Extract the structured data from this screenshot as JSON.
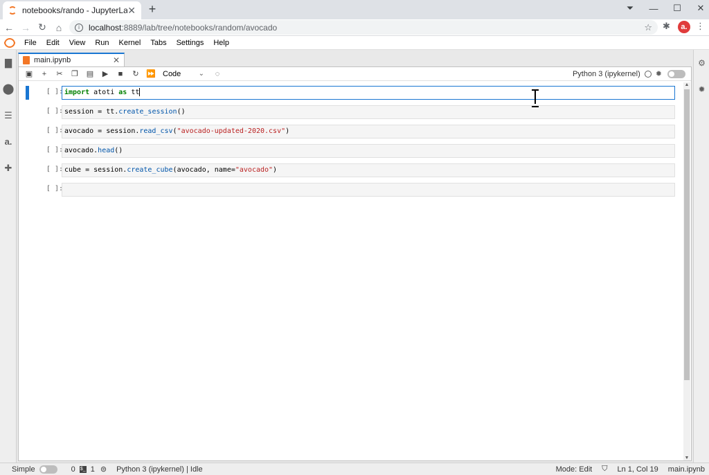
{
  "browser": {
    "tab_title": "notebooks/rando - JupyterLab",
    "url_host": "localhost",
    "url_path": ":8889/lab/tree/notebooks/random/avocado",
    "profile_initial": "a."
  },
  "menu": [
    "File",
    "Edit",
    "View",
    "Run",
    "Kernel",
    "Tabs",
    "Settings",
    "Help"
  ],
  "document": {
    "tab_name": "main.ipynb",
    "cell_type": "Code",
    "kernel_name": "Python 3 (ipykernel)"
  },
  "cells": [
    {
      "prompt": "[ ]:",
      "tokens": [
        {
          "t": "import",
          "c": "kw"
        },
        {
          "t": " atoti ",
          "c": ""
        },
        {
          "t": "as",
          "c": "kw"
        },
        {
          "t": " tt",
          "c": ""
        }
      ]
    },
    {
      "prompt": "[ ]:",
      "tokens": [
        {
          "t": "session = tt.",
          "c": ""
        },
        {
          "t": "create_session",
          "c": "fn"
        },
        {
          "t": "()",
          "c": ""
        }
      ]
    },
    {
      "prompt": "[ ]:",
      "tokens": [
        {
          "t": "avocado = session.",
          "c": ""
        },
        {
          "t": "read_csv",
          "c": "fn"
        },
        {
          "t": "(",
          "c": ""
        },
        {
          "t": "\"avocado-updated-2020.csv\"",
          "c": "str"
        },
        {
          "t": ")",
          "c": ""
        }
      ]
    },
    {
      "prompt": "[ ]:",
      "tokens": [
        {
          "t": "avocado.",
          "c": ""
        },
        {
          "t": "head",
          "c": "fn"
        },
        {
          "t": "()",
          "c": ""
        }
      ]
    },
    {
      "prompt": "[ ]:",
      "tokens": [
        {
          "t": "cube = session.",
          "c": ""
        },
        {
          "t": "create_cube",
          "c": "fn"
        },
        {
          "t": "(avocado, name=",
          "c": ""
        },
        {
          "t": "\"avocado\"",
          "c": "str"
        },
        {
          "t": ")",
          "c": ""
        }
      ]
    },
    {
      "prompt": "[ ]:",
      "tokens": []
    }
  ],
  "status": {
    "mode_label": "Simple",
    "terminals": "0",
    "kernels": "1",
    "kernel_status": "Python 3 (ipykernel) | Idle",
    "mode": "Mode: Edit",
    "position": "Ln 1, Col 19",
    "file": "main.ipynb"
  },
  "icons": {
    "sidebar": [
      "folder-icon",
      "running-icon",
      "toc-icon",
      "atoti-icon",
      "extension-icon"
    ],
    "toolbar": [
      "save-icon",
      "add-cell-icon",
      "cut-icon",
      "copy-icon",
      "paste-icon",
      "run-icon",
      "stop-icon",
      "restart-icon",
      "fast-forward-icon"
    ]
  },
  "colors": {
    "accent": "#1976d2",
    "jupyter_orange": "#f37726",
    "profile": "#e03b3b"
  }
}
